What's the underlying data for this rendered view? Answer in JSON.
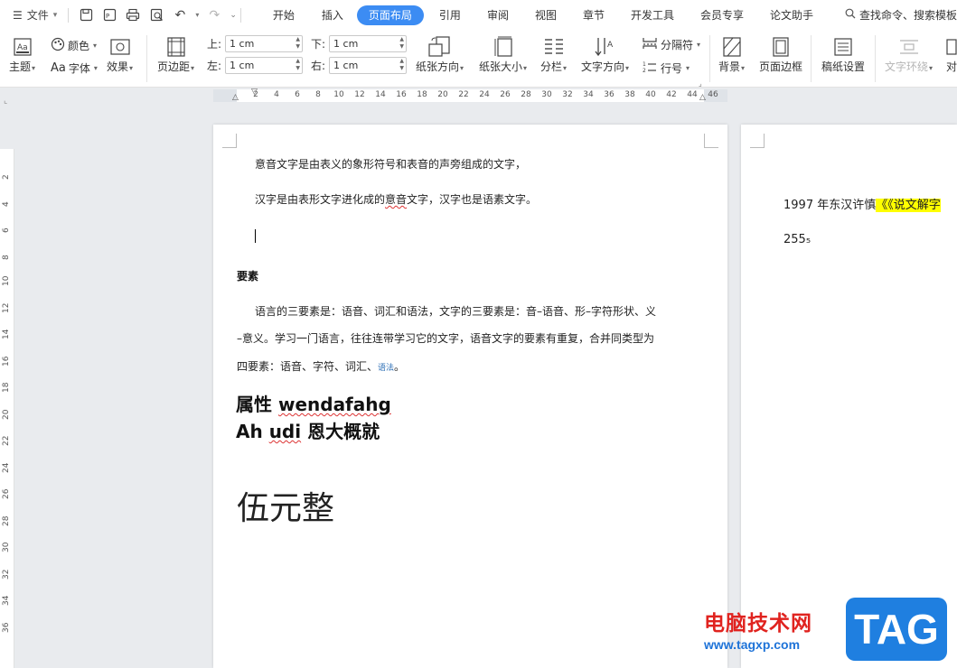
{
  "menu": {
    "label": "文件"
  },
  "tabs": [
    {
      "label": "开始"
    },
    {
      "label": "插入"
    },
    {
      "label": "页面布局"
    },
    {
      "label": "引用"
    },
    {
      "label": "审阅"
    },
    {
      "label": "视图"
    },
    {
      "label": "章节"
    },
    {
      "label": "开发工具"
    },
    {
      "label": "会员专享"
    },
    {
      "label": "论文助手"
    }
  ],
  "search": {
    "label": "查找命令、搜索模板"
  },
  "ribbon": {
    "theme": "主题",
    "color": "颜色",
    "font": "字体",
    "effect": "效果",
    "margin": "页边距",
    "top_label": "上:",
    "top_value": "1 cm",
    "bottom_label": "下:",
    "bottom_value": "1 cm",
    "left_label": "左:",
    "left_value": "1 cm",
    "right_label": "右:",
    "right_value": "1 cm",
    "orientation": "纸张方向",
    "size": "纸张大小",
    "columns": "分栏",
    "text_direction": "文字方向",
    "separator": "分隔符",
    "line_number": "行号",
    "background": "背景",
    "page_border": "页面边框",
    "draft_paper": "稿纸设置",
    "text_wrap": "文字环绕",
    "align": "对"
  },
  "ruler": {
    "numbers": [
      "2",
      "4",
      "6",
      "8",
      "10",
      "12",
      "14",
      "16",
      "18",
      "20",
      "22",
      "24",
      "26",
      "28",
      "30",
      "32",
      "34",
      "36",
      "38",
      "40",
      "42",
      "44",
      "46"
    ],
    "vnumbers": [
      "2",
      "4",
      "6",
      "8",
      "10",
      "12",
      "14",
      "16",
      "18",
      "20",
      "22",
      "24",
      "26",
      "28",
      "30",
      "32",
      "34",
      "36"
    ]
  },
  "document": {
    "p1": "意音文字是由表义的象形符号和表音的声旁组成的文字，",
    "p2_a": "汉字是由表形文字进化成的",
    "p2_b": "意音",
    "p2_c": "文字，汉字也是语素文字。",
    "heading1": "要素",
    "p3_line1": "语言的三要素是：语音、词汇和语法，文字的三要素是：音–语音、形–字符形状、义",
    "p3_line2": "–意义。学习一门语言，往往连带学习它的文字，语音文字的要素有重复，合并同类型为",
    "p3_line3_a": "四要素：语音、字符、词汇、",
    "p3_line3_link": "语法",
    "p3_line3_end": "。",
    "h2_a": "属性 ",
    "h2_b": "wendafahg",
    "h3_a": "Ah ",
    "h3_b": "udi",
    "h3_c": " 恩大概就",
    "big": "伍元整"
  },
  "page2": {
    "line1_a": "1997 年东汉许慎",
    "line1_hl": "《《说文解字",
    "line2": "255₅"
  },
  "watermark": {
    "text": "电脑技术网",
    "url": "www.tagxp.com",
    "tag": "TAG"
  },
  "colors": {
    "accent": "#3c8cf3",
    "highlight": "#ffff00",
    "watermark_red": "#e0231f",
    "watermark_blue": "#1f7fe0"
  }
}
